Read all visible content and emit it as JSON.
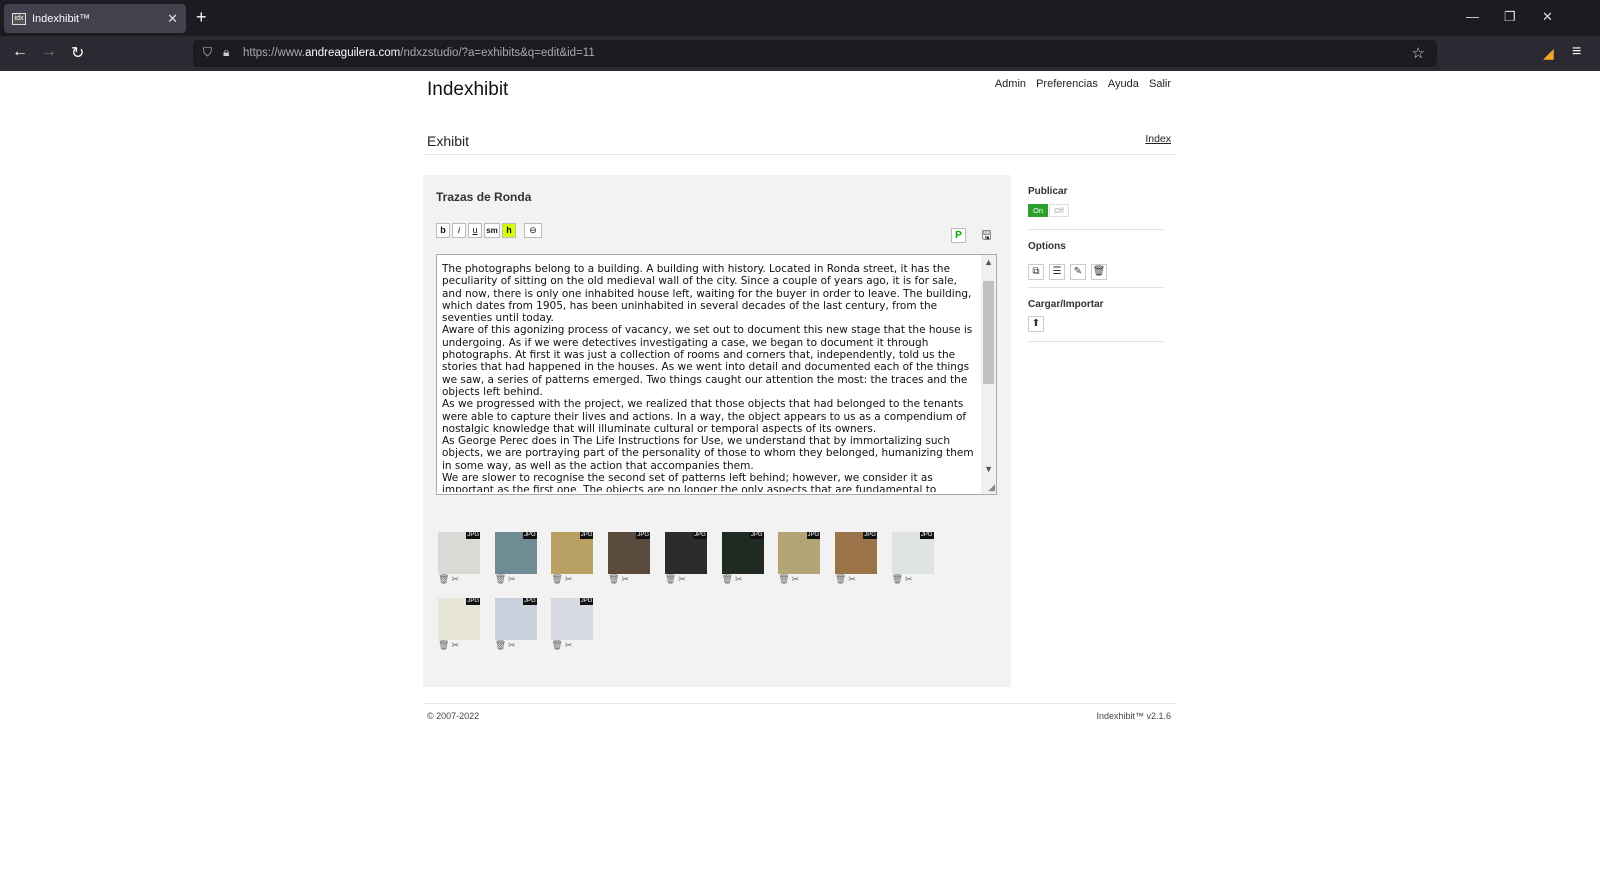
{
  "browser": {
    "tab_title": "Indexhibit™",
    "tab_favicon": "idx",
    "url_prefix": "https://www.",
    "url_domain": "andreaguilera.com",
    "url_path": "/ndxzstudio/?a=exhibits&q=edit&id=11"
  },
  "header": {
    "site_title": "Indexhibit",
    "nav": [
      "Admin",
      "Preferencias",
      "Ayuda",
      "Salir"
    ]
  },
  "section": {
    "title": "Exhibit",
    "index_link": "Index"
  },
  "editor": {
    "exhibit_title": "Trazas de Ronda",
    "toolbar": [
      "b",
      "i",
      "u",
      "sm",
      "h"
    ],
    "link_icon": "link-icon",
    "p_button": "P",
    "body_text": "The photographs belong to a building. A building with history. Located in Ronda street, it has the peculiarity of sitting on the old medieval wall of the city. Since a couple of years ago, it is for sale, and now, there is only one inhabited house left, waiting for the buyer in order to leave. The building, which dates from 1905, has been uninhabited in several decades of the last century, from the seventies until today.\nAware of this agonizing process of vacancy, we set out to document this new stage that the house is undergoing. As if we were detectives investigating a case, we began to document it through photographs. At first it was just a collection of rooms and corners that, independently, told us the stories that had happened in the houses. As we went into detail and documented each of the things we saw, a series of patterns emerged. Two things caught our attention the most: the traces and the objects left behind.\nAs we progressed with the project, we realized that those objects that had belonged to the tenants were able to capture their lives and actions. In a way, the object appears to us as a compendium of nostalgic knowledge that will illuminate cultural or temporal aspects of its owners.\nAs George Perec does in The Life Instructions for Use, we understand that by immortalizing such objects, we are portraying part of the personality of those to whom they belonged, humanizing them in some way, as well as the action that accompanies them.\nWe are slower to recognise the second set of patterns left behind; however, we consider it as important as the first one. The objects are no longer the only aspects that are fundamental to"
  },
  "images": [
    {
      "tag": "JPG",
      "color": "#d9d9d6"
    },
    {
      "tag": "JPG",
      "color": "#6f8b93"
    },
    {
      "tag": "JPG",
      "color": "#b8a163"
    },
    {
      "tag": "JPG",
      "color": "#5a4a3c"
    },
    {
      "tag": "JPG",
      "color": "#2c2c2c"
    },
    {
      "tag": "JPG",
      "color": "#1f2a22"
    },
    {
      "tag": "JPG",
      "color": "#b3a477"
    },
    {
      "tag": "JPG",
      "color": "#9a7448"
    },
    {
      "tag": "JPG",
      "color": "#dfe3e3"
    },
    {
      "tag": "JPG",
      "color": "#e8e6d9"
    },
    {
      "tag": "JPG",
      "color": "#c9d2dc"
    },
    {
      "tag": "JPG",
      "color": "#d7d9e0"
    }
  ],
  "sidebar": {
    "publish_label": "Publicar",
    "on": "On",
    "off": "Off",
    "options_label": "Options",
    "options_icons": [
      "copy-icon",
      "list-icon",
      "edit-icon",
      "trash-icon"
    ],
    "upload_label": "Cargar/Importar"
  },
  "footer": {
    "copyright": "© 2007-2022",
    "version": "Indexhibit™ v2.1.6"
  }
}
